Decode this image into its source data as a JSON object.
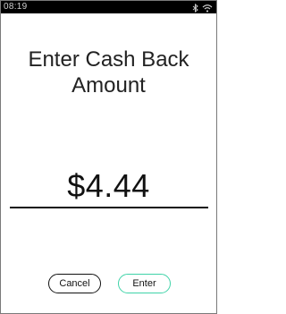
{
  "status_bar": {
    "time": "08:19",
    "icons": [
      "bluetooth-icon",
      "wifi-icon"
    ]
  },
  "title": {
    "line1": "Enter Cash Back",
    "line2": "Amount"
  },
  "amount": {
    "value": "$4.44"
  },
  "buttons": {
    "cancel_label": "Cancel",
    "enter_label": "Enter"
  },
  "colors": {
    "accent": "#3fd3a8",
    "text": "#111111",
    "status_bar_bg": "#000000"
  }
}
